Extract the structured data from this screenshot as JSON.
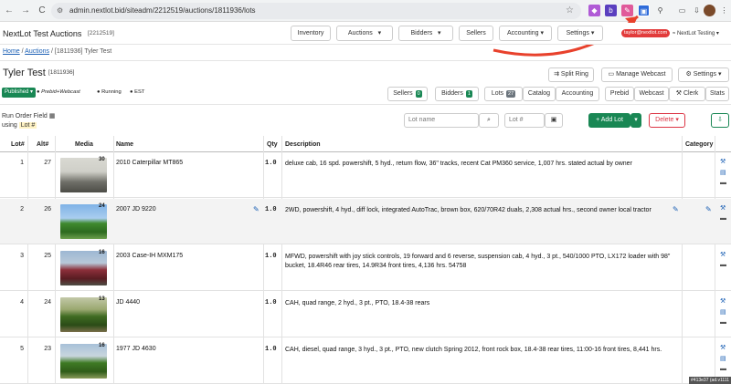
{
  "browser": {
    "url": "admin.nextlot.bid/siteadm/2212519/auctions/1811936/lots",
    "nav": {
      "back": "←",
      "forward": "→",
      "reload": "C"
    }
  },
  "header": {
    "title": "NextLot Test Auctions",
    "site_id": "[2212519]",
    "menu": [
      "Inventory",
      "Auctions",
      "Bidders",
      "Sellers",
      "Accounting",
      "Settings"
    ],
    "user_email": "taylor@nextlot.com",
    "user_label": "NextLot Testing"
  },
  "breadcrumb": {
    "home": "Home",
    "sep": "/",
    "auctions": "Auctions",
    "current": "[1811936] Tyler Test"
  },
  "auction": {
    "title": "Tyler Test",
    "id": "[1811936]",
    "status": "Published",
    "flags": [
      "Prebid+Webcast",
      "Running",
      "EST"
    ],
    "split_ring": "Split Ring",
    "manage_webcast": "Manage Webcast",
    "settings": "Settings",
    "tabs": {
      "sellers": "Sellers",
      "sellers_count": "0",
      "bidders": "Bidders",
      "bidders_count": "1",
      "lots": "Lots",
      "lots_count": "27",
      "catalog": "Catalog",
      "accounting": "Accounting",
      "prebid": "Prebid",
      "webcast": "Webcast",
      "clerk": "Clerk",
      "stats": "Stats"
    }
  },
  "toolbar": {
    "order_label": "Run Order Field",
    "using": "using",
    "order_field": "Lot #",
    "lot_name_placeholder": "Lot name",
    "lot_num_placeholder": "Lot #",
    "add_lot": "+ Add Lot",
    "delete": "Delete"
  },
  "table": {
    "headers": [
      "Lot#",
      "Alt#",
      "Media",
      "Name",
      "Qty",
      "Description",
      "Category"
    ],
    "rows": [
      {
        "lot": "1",
        "alt": "27",
        "media": "30",
        "name": "2010 Caterpillar MT865",
        "qty": "1.0",
        "desc": "deluxe cab, 16 spd. powershift, 5 hyd., return flow, 36\" tracks, recent Cat PM360 service, 1,007 hrs. stated actual by owner"
      },
      {
        "lot": "2",
        "alt": "26",
        "media": "24",
        "name": "2007 JD 9220",
        "qty": "1.0",
        "desc": "2WD, powershift, 4 hyd., diff lock, integrated AutoTrac, brown box, 620/70R42 duals, 2,308 actual hrs., second owner local tractor"
      },
      {
        "lot": "3",
        "alt": "25",
        "media": "16",
        "name": "2003 Case-IH MXM175",
        "qty": "1.0",
        "desc": "MFWD, powershift with joy stick controls, 19 forward and 6 reverse, suspension cab, 4 hyd., 3 pt., 540/1000 PTO, LX172 loader with 98\" bucket, 18.4R46 rear tires, 14.9R34 front tires, 4,136 hrs. 54758"
      },
      {
        "lot": "4",
        "alt": "24",
        "media": "13",
        "name": "JD 4440",
        "qty": "1.0",
        "desc": "CAH, quad range, 2 hyd., 3 pt., PTO, 18.4-38 rears"
      },
      {
        "lot": "5",
        "alt": "23",
        "media": "16",
        "name": "1977 JD 4630",
        "qty": "1.0",
        "desc": "CAH, diesel, quad range, 3 hyd., 3 pt., PTO, new clutch Spring 2012, front rock box, 18.4-38 rear tires, 11:00-16 front tires, 8,441 hrs."
      }
    ]
  },
  "footer_tag": "#413e37 (ad.v1111"
}
